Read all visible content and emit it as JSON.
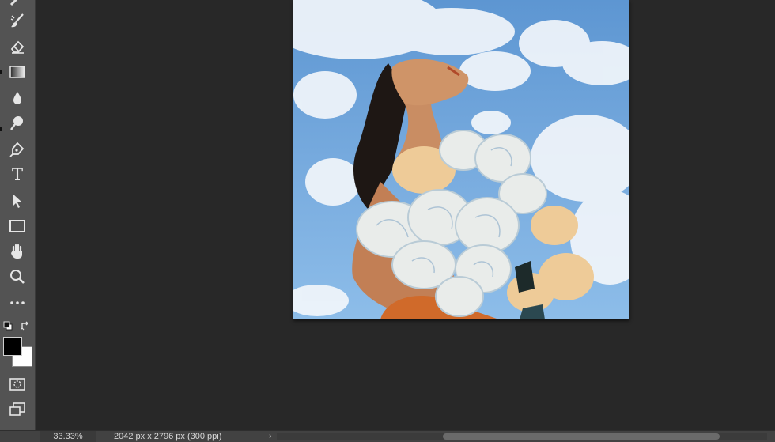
{
  "toolbar": {
    "tools": [
      {
        "name": "brush-tool",
        "icon": "brush-icon"
      },
      {
        "name": "eraser-tool",
        "icon": "eraser-icon"
      },
      {
        "name": "gradient-tool",
        "icon": "gradient-icon"
      },
      {
        "name": "blur-tool",
        "icon": "drop-icon"
      },
      {
        "name": "dodge-tool",
        "icon": "dodge-icon"
      },
      {
        "name": "pen-tool",
        "icon": "pen-icon"
      },
      {
        "name": "type-tool",
        "icon": "type-icon"
      },
      {
        "name": "path-selection-tool",
        "icon": "arrow-icon"
      },
      {
        "name": "rectangle-tool",
        "icon": "rectangle-icon"
      },
      {
        "name": "hand-tool",
        "icon": "hand-icon"
      },
      {
        "name": "zoom-tool",
        "icon": "magnifier-icon"
      },
      {
        "name": "edit-toolbar",
        "icon": "more-icon"
      }
    ],
    "type_glyph": "T",
    "foreground_color": "#000000",
    "background_color": "#ffffff"
  },
  "status": {
    "zoom": "33.33%",
    "doc_info": "2042 px x 2796 px (300 ppi)",
    "arrow": "›"
  }
}
